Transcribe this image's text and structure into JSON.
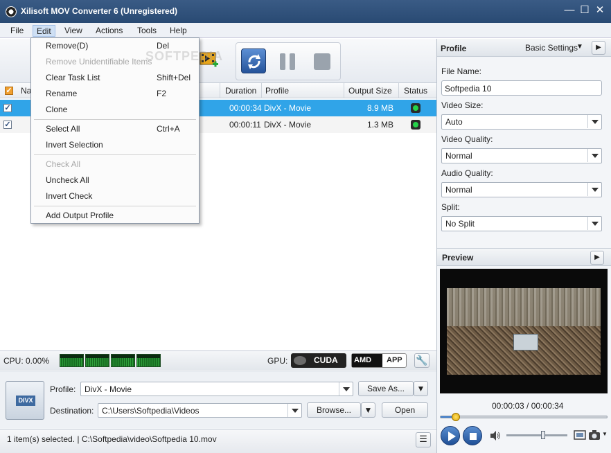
{
  "window": {
    "title": "Xilisoft MOV Converter 6 (Unregistered)"
  },
  "menu": {
    "items": [
      "File",
      "Edit",
      "View",
      "Actions",
      "Tools",
      "Help"
    ]
  },
  "context_menu": {
    "groups": [
      [
        {
          "label": "Remove(D)",
          "shortcut": "Del",
          "disabled": false
        },
        {
          "label": "Remove Unidentifiable Items",
          "shortcut": "",
          "disabled": true
        },
        {
          "label": "Clear Task List",
          "shortcut": "Shift+Del",
          "disabled": false
        },
        {
          "label": "Rename",
          "shortcut": "F2",
          "disabled": false
        },
        {
          "label": "Clone",
          "shortcut": "",
          "disabled": false
        }
      ],
      [
        {
          "label": "Select All",
          "shortcut": "Ctrl+A",
          "disabled": false
        },
        {
          "label": "Invert Selection",
          "shortcut": "",
          "disabled": false
        }
      ],
      [
        {
          "label": "Check All",
          "shortcut": "",
          "disabled": true
        },
        {
          "label": "Uncheck All",
          "shortcut": "",
          "disabled": false
        },
        {
          "label": "Invert Check",
          "shortcut": "",
          "disabled": false
        }
      ],
      [
        {
          "label": "Add Output Profile",
          "shortcut": "",
          "disabled": false
        }
      ]
    ]
  },
  "file_list": {
    "columns": {
      "name": "Na",
      "duration": "Duration",
      "profile": "Profile",
      "output_size": "Output Size",
      "status": "Status"
    },
    "rows": [
      {
        "duration": "00:00:34",
        "profile": "DivX - Movie",
        "output_size": "8.9 MB",
        "selected": true,
        "checked": true
      },
      {
        "duration": "00:00:11",
        "profile": "DivX - Movie",
        "output_size": "1.3 MB",
        "selected": false,
        "checked": true
      }
    ]
  },
  "cpu": {
    "label": "CPU: 0.00%"
  },
  "gpu": {
    "label": "GPU:",
    "cuda": "CUDA",
    "amd": "AMD",
    "app": "APP"
  },
  "bottom": {
    "profile_label": "Profile:",
    "profile_value": "DivX - Movie",
    "save_as": "Save As...",
    "destination_label": "Destination:",
    "destination_value": "C:\\Users\\Softpedia\\Videos",
    "browse": "Browse...",
    "open": "Open",
    "profile_badge": "DIVX"
  },
  "statusbar": {
    "text": "1 item(s) selected. | C:\\Softpedia\\video\\Softpedia 10.mov"
  },
  "right_panel": {
    "profile_title": "Profile",
    "basic_settings": "Basic Settings",
    "file_name_label": "File Name:",
    "file_name_value": "Softpedia 10",
    "video_size_label": "Video Size:",
    "video_size_value": "Auto",
    "video_quality_label": "Video Quality:",
    "video_quality_value": "Normal",
    "audio_quality_label": "Audio Quality:",
    "audio_quality_value": "Normal",
    "split_label": "Split:",
    "split_value": "No Split",
    "preview_title": "Preview",
    "time": "00:00:03 / 00:00:34",
    "seek_progress": 0.09,
    "volume_level": 0.6
  },
  "watermark": "SOFTPEDIA",
  "colors": {
    "titlebar": "#2f5180",
    "selection": "#30a4e8",
    "status_ok": "#25d34a"
  }
}
